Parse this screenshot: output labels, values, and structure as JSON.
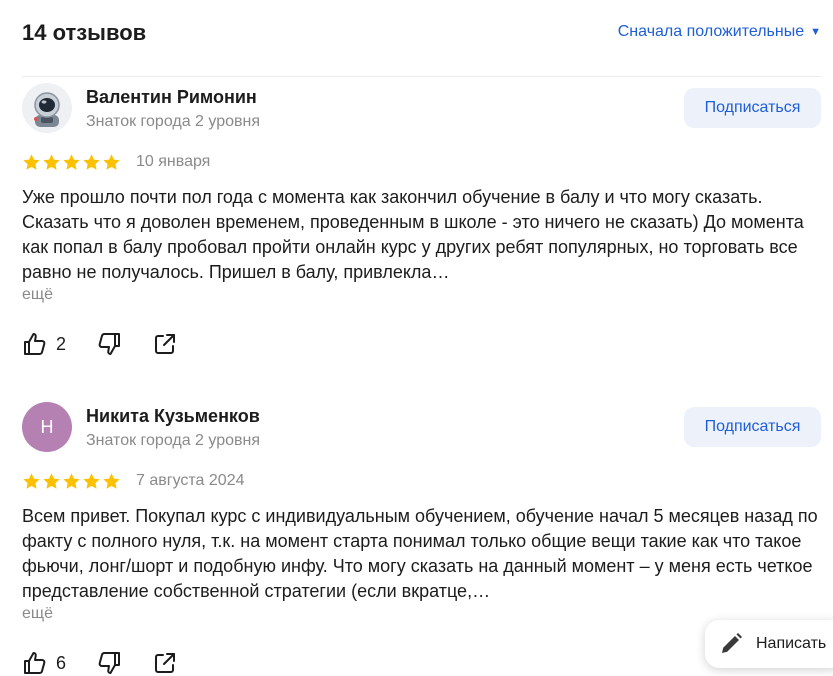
{
  "header": {
    "title": "14 отзывов",
    "sort_label": "Сначала положительные"
  },
  "reviews": [
    {
      "author": "Валентин Римонин",
      "level": "Знаток города 2 уровня",
      "avatar_icon": "astronaut-avatar-icon",
      "avatar_letter": "",
      "subscribe_label": "Подписаться",
      "rating": 5,
      "date": "10 января",
      "text": "Уже прошло почти пол года с момента как закончил обучение в балу и что могу сказать. Сказать что я доволен временем, проведенным в школе - это ничего не сказать) До момента как попал в балу пробовал пройти онлайн курс у других ребят популярных, но торговать все равно не получалось. Пришел в балу, привлекла…",
      "more_label": "ещё",
      "likes": "2"
    },
    {
      "author": "Никита Кузьменков",
      "level": "Знаток города 2 уровня",
      "avatar_icon": "",
      "avatar_letter": "Н",
      "subscribe_label": "Подписаться",
      "rating": 5,
      "date": "7 августа 2024",
      "text": "Всем привет. Покупал курс с индивидуальным обучением, обучение начал 5 месяцев назад по факту с полного нуля, т.к. на момент старта понимал только общие вещи такие как что такое фьючи, лонг/шорт и подобную инфу. Что могу сказать на данный момент – у меня есть четкое представление собственной стратегии (если вкратце,…",
      "more_label": "ещё",
      "likes": "6"
    }
  ],
  "write_button": {
    "label": "Написать"
  },
  "colors": {
    "accent": "#1e5ed6",
    "star": "#fcc102",
    "muted_text": "#8a8a8a",
    "subscribe_bg": "#edf2fa",
    "avatar_letter_bg": "#b581b3"
  }
}
